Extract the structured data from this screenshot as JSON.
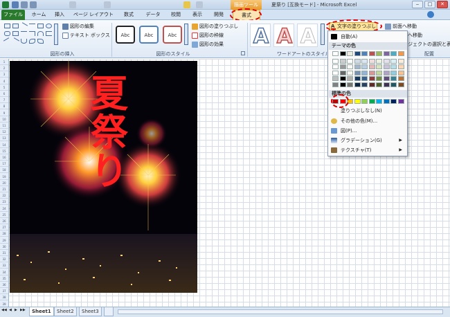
{
  "window": {
    "contextual_group": "描画ツール",
    "title": "夏祭り [互換モード] - Microsoft Excel",
    "min_glyph": "‒",
    "max_glyph": "□",
    "close_glyph": "✕"
  },
  "tabs": [
    {
      "label": "ファイル"
    },
    {
      "label": "ホーム"
    },
    {
      "label": "挿入"
    },
    {
      "label": "ページ レイアウト"
    },
    {
      "label": "数式"
    },
    {
      "label": "データ"
    },
    {
      "label": "校閲"
    },
    {
      "label": "表示"
    },
    {
      "label": "開発"
    },
    {
      "label": "書式"
    }
  ],
  "ribbon": {
    "insert_shapes": {
      "edit_shape": "図形の編集",
      "text_box": "テキスト ボックス",
      "group_label": "図形の挿入"
    },
    "shape_styles": {
      "sample": "Abc",
      "fill": "図形の塗りつぶし",
      "outline": "図形の枠線",
      "effects": "図形の効果",
      "group_label": "図形のスタイル"
    },
    "wordart": {
      "sample_letter": "A",
      "text_fill": "文字の塗りつぶし",
      "group_label": "ワードアートのスタイル"
    },
    "arrange": {
      "bring_forward": "前面へ移動",
      "send_backward": "へ移動",
      "selection_pane": "ジェクトの選択と表示",
      "group_label": "配置"
    }
  },
  "menu": {
    "auto": "自動(A)",
    "theme_header": "テーマの色",
    "standard_header": "標準の色",
    "no_fill": "塗りつぶしなし(N)",
    "more_colors": "その他の色(M)...",
    "picture": "図(P)...",
    "gradient": "グラデーション(G)",
    "texture": "テクスチャ(T)",
    "submenu_arrow": "▶",
    "theme_colors": [
      "#ffffff",
      "#000000",
      "#eeece1",
      "#1f497d",
      "#4f81bd",
      "#c0504d",
      "#9bbb59",
      "#8064a2",
      "#4bacc6",
      "#f79646"
    ],
    "standard_colors": [
      "#c00000",
      "#ff0000",
      "#ffc000",
      "#ffff00",
      "#92d050",
      "#00b050",
      "#00b0f0",
      "#0070c0",
      "#002060",
      "#7030a0"
    ]
  },
  "artwork": {
    "title": "夏祭り"
  },
  "sheets": [
    "Sheet1",
    "Sheet2",
    "Sheet3"
  ],
  "sheet_nav": [
    "◀◀",
    "◀",
    "▶",
    "▶▶"
  ]
}
